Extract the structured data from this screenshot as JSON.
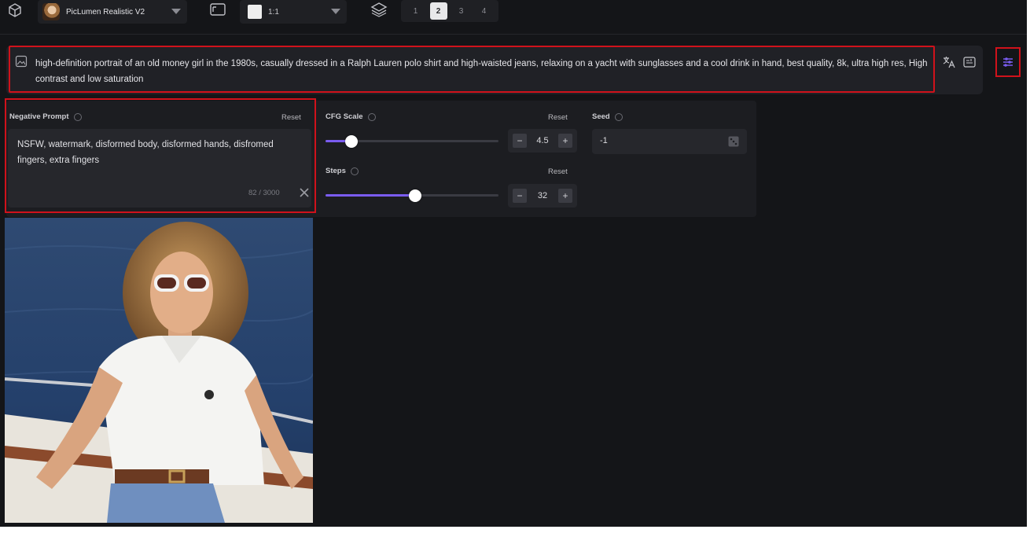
{
  "toolbar": {
    "model_label": "PicLumen Realistic V2",
    "ratio_label": "1:1",
    "image_counts": [
      "1",
      "2",
      "3",
      "4"
    ],
    "selected_count": "2"
  },
  "prompt": {
    "text": "high-definition portrait of an old money girl in the 1980s, casually dressed in a Ralph Lauren polo shirt and high-waisted jeans, relaxing on a yacht with sunglasses and a cool drink in hand, best quality, 8k, ultra high res, High contrast and low saturation"
  },
  "negative_prompt": {
    "label": "Negative Prompt",
    "reset_label": "Reset",
    "text": "NSFW, watermark, disformed body, disformed hands, disfromed fingers, extra fingers",
    "counter": "82 / 3000"
  },
  "cfg_scale": {
    "label": "CFG Scale",
    "reset_label": "Reset",
    "value": "4.5",
    "slider_fraction": 0.15
  },
  "steps": {
    "label": "Steps",
    "reset_label": "Reset",
    "value": "32",
    "slider_fraction": 0.52
  },
  "seed": {
    "label": "Seed",
    "value": "-1"
  },
  "colors": {
    "accent": "#7a5cf0",
    "highlight_border": "#d0121b",
    "background": "#141518"
  },
  "icons": [
    "cube-icon",
    "aspect-ratio-icon",
    "layers-icon",
    "image-icon",
    "translate-icon",
    "expand-icon",
    "settings-sliders-icon",
    "help-icon",
    "close-icon",
    "dice-icon",
    "minus-icon",
    "plus-icon"
  ]
}
